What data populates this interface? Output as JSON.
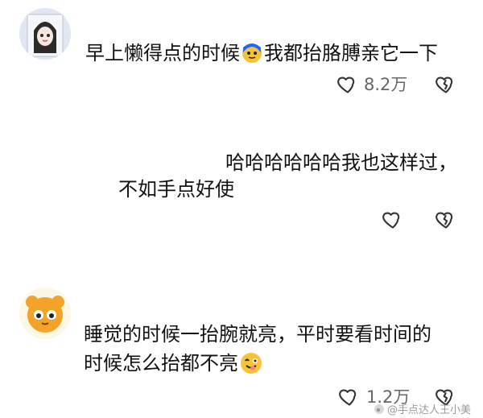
{
  "comments": [
    {
      "text_before": "早上懒得点的时候",
      "text_after": "我都抬胳膊亲它一下",
      "emoji": "face-emoji-icon",
      "likes": "8.2万"
    },
    {
      "line1": "哈哈哈哈哈哈我也这样过，",
      "line2": "不如手点好使"
    },
    {
      "line1": "睡觉的时候一抬腕就亮，平时要看时间的",
      "line2_before": "时候怎么抬都不亮",
      "emoji": "drooling-face-emoji-icon",
      "likes": "1.2万"
    }
  ],
  "watermark": "@手点达人王小美",
  "colors": {
    "text": "#111111",
    "meta": "#666666",
    "icon_stroke": "#333333"
  }
}
